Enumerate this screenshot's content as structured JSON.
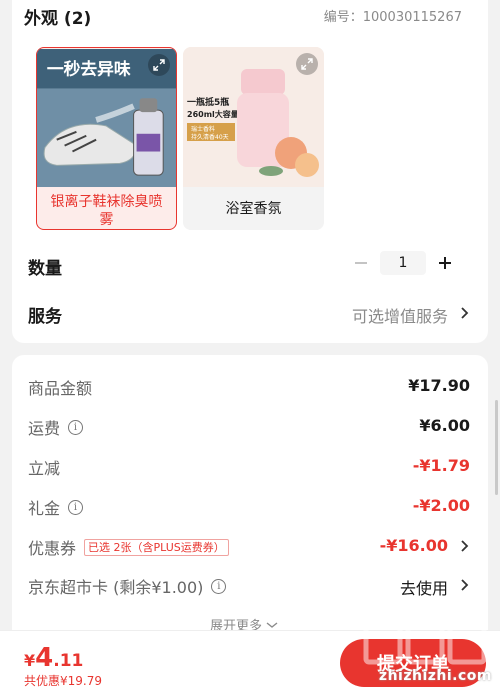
{
  "appearance": {
    "title": "外观 (2)",
    "sku_number": "编号：100030115267",
    "options": [
      {
        "label": "银离子鞋袜除臭喷雾",
        "banner": "一秒去异味",
        "selected": true
      },
      {
        "label": "浴室香氛",
        "banner_line1": "一瓶抵5瓶",
        "banner_line2": "260ml大容量",
        "banner_line3": "瑞士香料",
        "banner_line4": "持久清香40天",
        "selected": false
      }
    ]
  },
  "quantity": {
    "label": "数量",
    "value": "1",
    "minus": "−",
    "plus": "+"
  },
  "service": {
    "label": "服务",
    "value": "可选增值服务"
  },
  "fees": {
    "goods": {
      "label": "商品金额",
      "value": "¥17.90"
    },
    "shipping": {
      "label": "运费",
      "value": "¥6.00",
      "info": "i"
    },
    "discount": {
      "label": "立减",
      "value": "-¥1.79"
    },
    "gift": {
      "label": "礼金",
      "value": "-¥2.00",
      "info": "i"
    },
    "coupon": {
      "label": "优惠券",
      "tag": "已选 2张（含PLUS运费券）",
      "value": "-¥16.00"
    },
    "card": {
      "label": "京东超市卡 (剩余¥1.00)",
      "value": "去使用",
      "info": "i"
    },
    "more": "展开更多"
  },
  "checkout": {
    "currency": "¥",
    "total_int": "4",
    "total_dec": ".11",
    "saved": "共优惠¥19.79",
    "submit": "提交订单"
  },
  "watermark": {
    "text": "zhizhizhi.com"
  },
  "colors": {
    "accent": "#e8352f",
    "muted": "#8a8a8a",
    "background": "#f2f2f2"
  }
}
